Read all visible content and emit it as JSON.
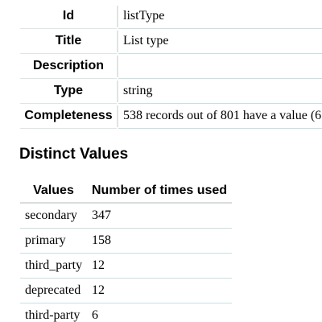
{
  "field": {
    "rows": [
      {
        "key": "Id",
        "value": "listType"
      },
      {
        "key": "Title",
        "value": "List type"
      },
      {
        "key": "Description",
        "value": ""
      },
      {
        "key": "Type",
        "value": "string"
      },
      {
        "key": "Completeness",
        "value": "538 records out of 801 have a value (6"
      }
    ]
  },
  "distinct": {
    "heading": "Distinct Values",
    "columns": [
      "Values",
      "Number of times used"
    ],
    "rows": [
      {
        "value": "secondary",
        "count": "347"
      },
      {
        "value": "primary",
        "count": "158"
      },
      {
        "value": "third_party",
        "count": "12"
      },
      {
        "value": "deprecated",
        "count": "12"
      },
      {
        "value": "third-party",
        "count": "6"
      }
    ]
  }
}
